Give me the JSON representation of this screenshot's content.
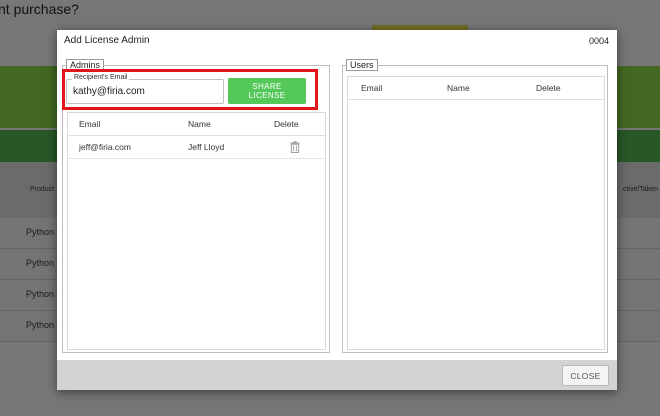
{
  "background": {
    "title": "nt purchase?",
    "header_left": "Product",
    "header_right": "ctive/Taken",
    "rows": [
      "Python v",
      "Python v",
      "Python v",
      "Python v"
    ]
  },
  "modal": {
    "title": "Add License Admin",
    "code": "0004",
    "admins": {
      "legend": "Admins",
      "recipient_label": "Recipient's Email",
      "recipient_value": "kathy@firia.com",
      "share_label": "SHARE LICENSE",
      "columns": {
        "email": "Email",
        "name": "Name",
        "delete": "Delete"
      },
      "rows": [
        {
          "email": "jeff@firia.com",
          "name": "Jeff Lloyd",
          "delete_icon": "trash-icon"
        }
      ]
    },
    "users": {
      "legend": "Users",
      "columns": {
        "email": "Email",
        "name": "Name",
        "delete": "Delete"
      },
      "rows": []
    },
    "close_label": "CLOSE"
  },
  "colors": {
    "share_button": "#55c85a",
    "highlight": "#e3141c",
    "footer": "#d3d3d3"
  }
}
